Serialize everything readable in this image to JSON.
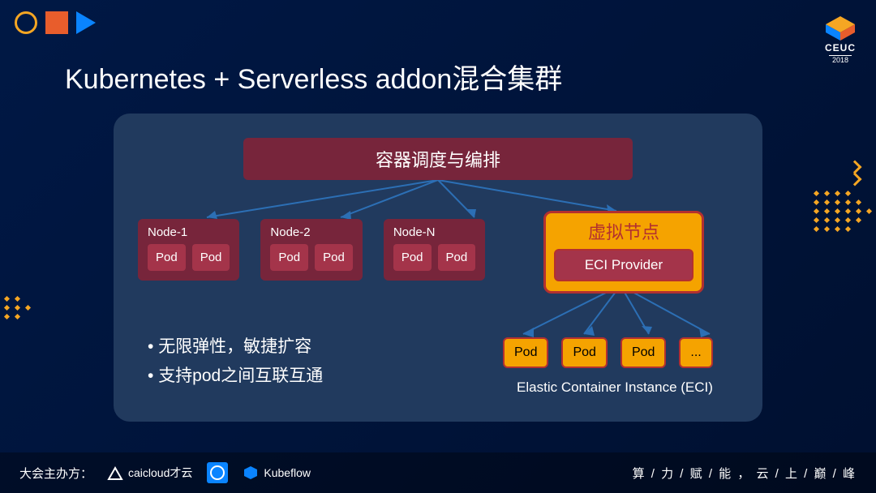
{
  "title": "Kubernetes + Serverless addon混合集群",
  "logo": {
    "brand": "CEUC",
    "year": "2018"
  },
  "orchestrator": "容器调度与编排",
  "nodes": [
    {
      "name": "Node-1",
      "pods": [
        "Pod",
        "Pod"
      ]
    },
    {
      "name": "Node-2",
      "pods": [
        "Pod",
        "Pod"
      ]
    },
    {
      "name": "Node-N",
      "pods": [
        "Pod",
        "Pod"
      ]
    }
  ],
  "virtual_node": {
    "title": "虚拟节点",
    "provider": "ECI Provider"
  },
  "bullets": [
    "无限弹性，敏捷扩容",
    "支持pod之间互联互通"
  ],
  "eci_pods": [
    "Pod",
    "Pod",
    "Pod",
    "..."
  ],
  "eci_label": "Elastic Container Instance (ECI)",
  "footer": {
    "host_label": "大会主办方：",
    "sponsors": [
      "caicloud才云",
      "",
      "Kubeflow"
    ],
    "slogan": "算 / 力 / 赋 / 能 ， 云 / 上 / 巅 / 峰"
  }
}
